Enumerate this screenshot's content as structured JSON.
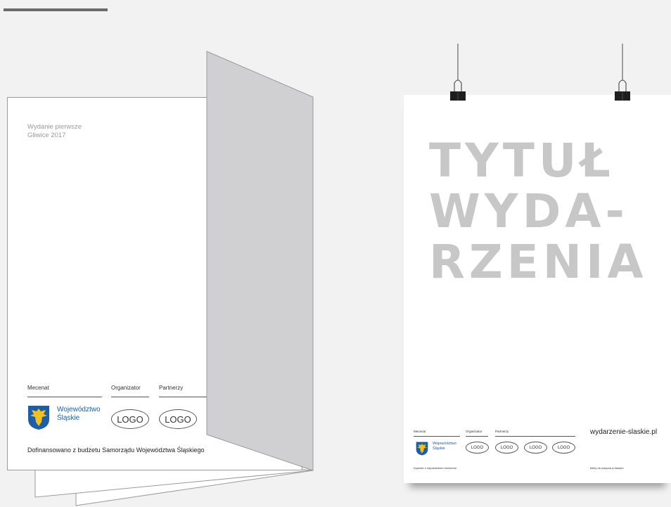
{
  "brochure": {
    "edition_line1": "Wydanie pierwsze",
    "edition_line2": "Gliwice 2017",
    "sponsor_label": "Mecenat",
    "organizer_label": "Organizator",
    "partners_label": "Partnerzy",
    "voivodeship_line1": "Województwo",
    "voivodeship_line2": "Śląskie",
    "logo_1": "LOGO",
    "logo_2": "LOGO",
    "funding_text": "Dofinansowano z budżetu Samorządu Województwa Śląskiego"
  },
  "poster": {
    "title_line1": "TYTUŁ",
    "title_line2": "WYDA-",
    "title_line3": "RZENIA",
    "sponsor_label": "Mecenat",
    "organizer_label": "Organizator",
    "partners_label": "Partnerzy",
    "voivodeship_line1": "Województwo",
    "voivodeship_line2": "Śląskie",
    "logos": [
      "LOGO",
      "LOGO",
      "LOGO",
      "LOGO"
    ],
    "url": "wydarzenie-slaskie.pl",
    "footnote_left": "Dopisek o odpowiednim brzmieniu",
    "footnote_right": "bilety do nabycia w kasach"
  },
  "colors": {
    "background": "#f2f2f2",
    "title_grey": "#c7c7c8",
    "flap_grey": "#d0d0d2",
    "voivodeship_blue": "#1d5ea8",
    "crest_yellow": "#f2c11a"
  }
}
